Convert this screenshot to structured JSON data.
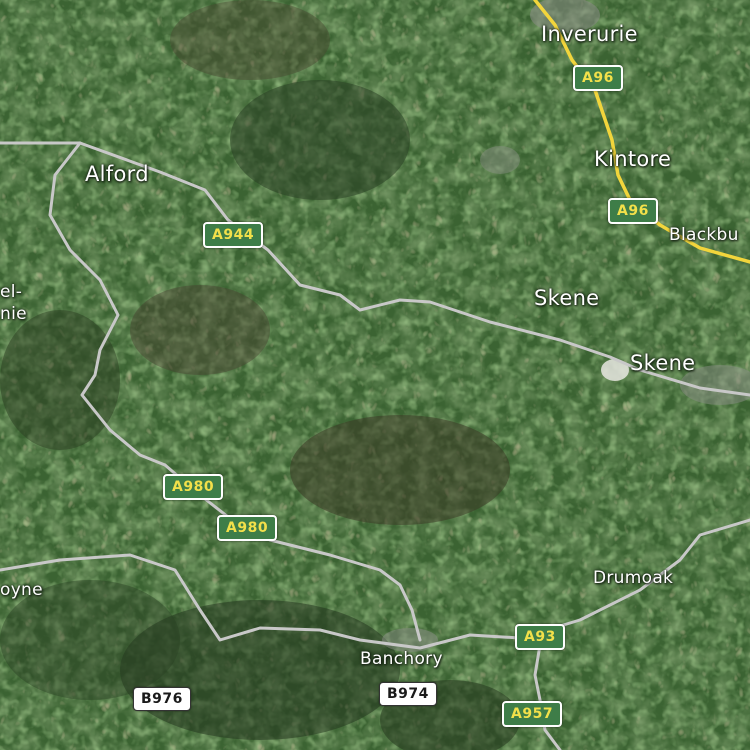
{
  "map": {
    "view": "satellite",
    "colors": {
      "road_major": "#c8c8c8",
      "road_primary_yellow": "#f2d53c",
      "shield_green": "#3e7d48",
      "shield_text_yellow": "#f2e04a",
      "shield_white": "#ffffff",
      "label_text": "#ffffff"
    },
    "places": [
      {
        "id": "inverurie",
        "label": "Inverurie"
      },
      {
        "id": "kintore",
        "label": "Kintore"
      },
      {
        "id": "blackburn",
        "label": "Blackbu"
      },
      {
        "id": "alford",
        "label": "Alford"
      },
      {
        "id": "skene-north",
        "label": "Skene"
      },
      {
        "id": "skene-east",
        "label": "Skene"
      },
      {
        "id": "kildrummy",
        "label": "el-\nnie"
      },
      {
        "id": "aboyne",
        "label": "oyne"
      },
      {
        "id": "drumoak",
        "label": "Drumoak"
      },
      {
        "id": "banchory",
        "label": "Banchory"
      }
    ],
    "road_shields": [
      {
        "id": "a96-north",
        "label": "A96",
        "class": "green"
      },
      {
        "id": "a96-south",
        "label": "A96",
        "class": "green"
      },
      {
        "id": "a944",
        "label": "A944",
        "class": "green"
      },
      {
        "id": "a980-north",
        "label": "A980",
        "class": "green"
      },
      {
        "id": "a980-south",
        "label": "A980",
        "class": "green"
      },
      {
        "id": "a93",
        "label": "A93",
        "class": "green"
      },
      {
        "id": "a957",
        "label": "A957",
        "class": "green"
      },
      {
        "id": "b976",
        "label": "B976",
        "class": "white"
      },
      {
        "id": "b974",
        "label": "B974",
        "class": "white"
      }
    ]
  }
}
